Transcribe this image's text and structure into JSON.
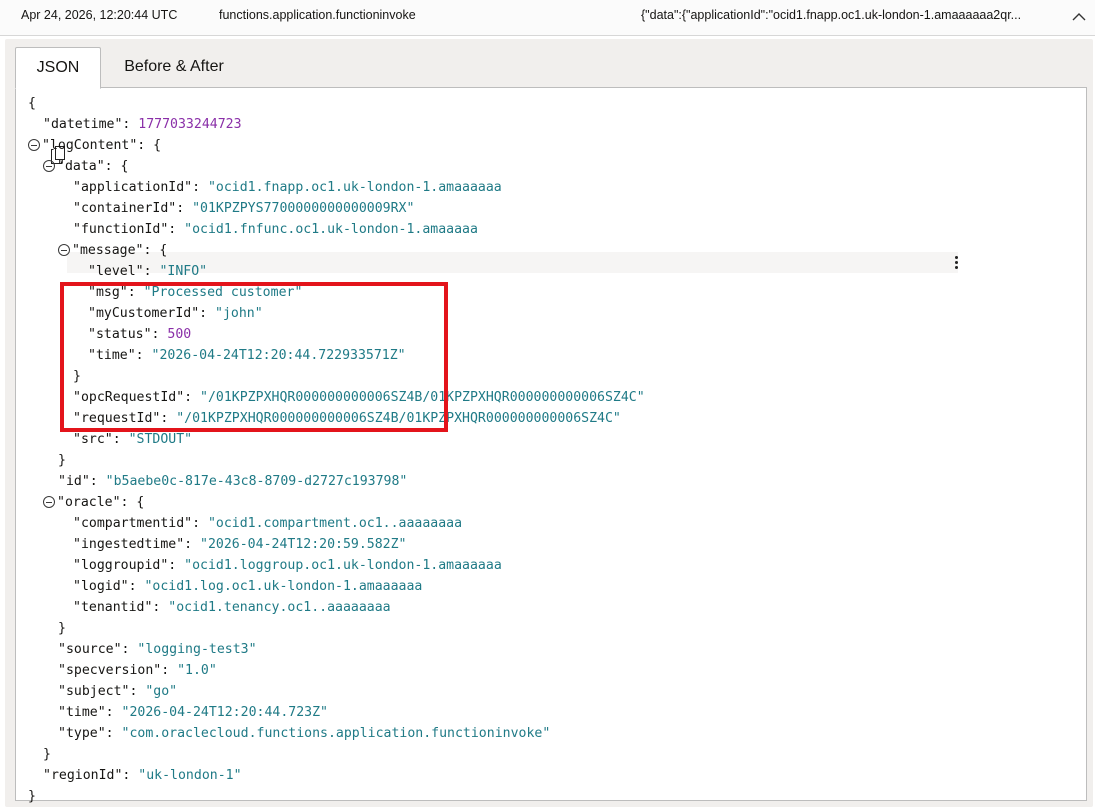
{
  "header": {
    "timestamp": "Apr 24, 2026, 12:20:44 UTC",
    "type": "functions.application.functioninvoke",
    "data_preview": "{\"data\":{\"applicationId\":\"ocid1.fnapp.oc1.uk-london-1.amaaaaaa2qr..."
  },
  "tabs": [
    {
      "label": "JSON",
      "active": true
    },
    {
      "label": "Before & After",
      "active": false
    }
  ],
  "icons": {
    "copy": "copy-icon",
    "collapse": "chevron-up-icon",
    "toggle": "collapse-toggle-icon",
    "kebab": "more-vertical-icon"
  },
  "colors": {
    "string": "#1f7a86",
    "number": "#8a2fa8",
    "highlight": "#e3141b"
  },
  "json_lines": [
    {
      "indent": 0,
      "parts": [
        {
          "t": "p",
          "v": "{"
        }
      ],
      "copy": true
    },
    {
      "indent": 1,
      "parts": [
        {
          "t": "k",
          "v": "\"datetime\""
        },
        {
          "t": "p",
          "v": ": "
        },
        {
          "t": "n",
          "v": "1777033244723"
        }
      ]
    },
    {
      "indent": 1,
      "toggle": true,
      "parts": [
        {
          "t": "k",
          "v": "\"logContent\""
        },
        {
          "t": "p",
          "v": ": {"
        }
      ]
    },
    {
      "indent": 2,
      "toggle": true,
      "parts": [
        {
          "t": "k",
          "v": "\"data\""
        },
        {
          "t": "p",
          "v": ": {"
        }
      ]
    },
    {
      "indent": 3,
      "parts": [
        {
          "t": "k",
          "v": "\"applicationId\""
        },
        {
          "t": "p",
          "v": ": "
        },
        {
          "t": "s",
          "v": "\"ocid1.fnapp.oc1.uk-london-1.amaaaaaa"
        }
      ]
    },
    {
      "indent": 3,
      "hover": true,
      "parts": [
        {
          "t": "k",
          "v": "\"containerId\""
        },
        {
          "t": "p",
          "v": ": "
        },
        {
          "t": "s",
          "v": "\"01KPZPYS7700000000000009RX\""
        }
      ]
    },
    {
      "indent": 3,
      "parts": [
        {
          "t": "k",
          "v": "\"functionId\""
        },
        {
          "t": "p",
          "v": ": "
        },
        {
          "t": "s",
          "v": "\"ocid1.fnfunc.oc1.uk-london-1.amaaaaa"
        }
      ]
    },
    {
      "indent": 3,
      "toggle": true,
      "parts": [
        {
          "t": "k",
          "v": "\"message\""
        },
        {
          "t": "p",
          "v": ": {"
        }
      ]
    },
    {
      "indent": 4,
      "parts": [
        {
          "t": "k",
          "v": "\"level\""
        },
        {
          "t": "p",
          "v": ": "
        },
        {
          "t": "s",
          "v": "\"INFO\""
        }
      ]
    },
    {
      "indent": 4,
      "parts": [
        {
          "t": "k",
          "v": "\"msg\""
        },
        {
          "t": "p",
          "v": ": "
        },
        {
          "t": "s",
          "v": "\"Processed customer\""
        }
      ]
    },
    {
      "indent": 4,
      "parts": [
        {
          "t": "k",
          "v": "\"myCustomerId\""
        },
        {
          "t": "p",
          "v": ": "
        },
        {
          "t": "s",
          "v": "\"john\""
        }
      ]
    },
    {
      "indent": 4,
      "parts": [
        {
          "t": "k",
          "v": "\"status\""
        },
        {
          "t": "p",
          "v": ": "
        },
        {
          "t": "n",
          "v": "500"
        }
      ]
    },
    {
      "indent": 4,
      "parts": [
        {
          "t": "k",
          "v": "\"time\""
        },
        {
          "t": "p",
          "v": ": "
        },
        {
          "t": "s",
          "v": "\"2026-04-24T12:20:44.722933571Z\""
        }
      ]
    },
    {
      "indent": 3,
      "parts": [
        {
          "t": "p",
          "v": "}"
        }
      ]
    },
    {
      "indent": 3,
      "parts": [
        {
          "t": "k",
          "v": "\"opcRequestId\""
        },
        {
          "t": "p",
          "v": ": "
        },
        {
          "t": "s",
          "v": "\"/01KPZPXHQR000000000006SZ4B/01KPZPXHQR000000000006SZ4C\""
        }
      ]
    },
    {
      "indent": 3,
      "parts": [
        {
          "t": "k",
          "v": "\"requestId\""
        },
        {
          "t": "p",
          "v": ": "
        },
        {
          "t": "s",
          "v": "\"/01KPZPXHQR000000000006SZ4B/01KPZPXHQR000000000006SZ4C\""
        }
      ]
    },
    {
      "indent": 3,
      "parts": [
        {
          "t": "k",
          "v": "\"src\""
        },
        {
          "t": "p",
          "v": ": "
        },
        {
          "t": "s",
          "v": "\"STDOUT\""
        }
      ]
    },
    {
      "indent": 2,
      "parts": [
        {
          "t": "p",
          "v": "}"
        }
      ]
    },
    {
      "indent": 2,
      "parts": [
        {
          "t": "k",
          "v": "\"id\""
        },
        {
          "t": "p",
          "v": ": "
        },
        {
          "t": "s",
          "v": "\"b5aebe0c-817e-43c8-8709-d2727c193798\""
        }
      ]
    },
    {
      "indent": 2,
      "toggle": true,
      "parts": [
        {
          "t": "k",
          "v": "\"oracle\""
        },
        {
          "t": "p",
          "v": ": {"
        }
      ]
    },
    {
      "indent": 3,
      "parts": [
        {
          "t": "k",
          "v": "\"compartmentid\""
        },
        {
          "t": "p",
          "v": ": "
        },
        {
          "t": "s",
          "v": "\"ocid1.compartment.oc1..aaaaaaaa"
        }
      ]
    },
    {
      "indent": 3,
      "parts": [
        {
          "t": "k",
          "v": "\"ingestedtime\""
        },
        {
          "t": "p",
          "v": ": "
        },
        {
          "t": "s",
          "v": "\"2026-04-24T12:20:59.582Z\""
        }
      ]
    },
    {
      "indent": 3,
      "parts": [
        {
          "t": "k",
          "v": "\"loggroupid\""
        },
        {
          "t": "p",
          "v": ": "
        },
        {
          "t": "s",
          "v": "\"ocid1.loggroup.oc1.uk-london-1.amaaaaaa"
        }
      ]
    },
    {
      "indent": 3,
      "parts": [
        {
          "t": "k",
          "v": "\"logid\""
        },
        {
          "t": "p",
          "v": ": "
        },
        {
          "t": "s",
          "v": "\"ocid1.log.oc1.uk-london-1.amaaaaaa"
        }
      ]
    },
    {
      "indent": 3,
      "parts": [
        {
          "t": "k",
          "v": "\"tenantid\""
        },
        {
          "t": "p",
          "v": ": "
        },
        {
          "t": "s",
          "v": "\"ocid1.tenancy.oc1..aaaaaaaa"
        }
      ]
    },
    {
      "indent": 2,
      "parts": [
        {
          "t": "p",
          "v": "}"
        }
      ]
    },
    {
      "indent": 2,
      "parts": [
        {
          "t": "k",
          "v": "\"source\""
        },
        {
          "t": "p",
          "v": ": "
        },
        {
          "t": "s",
          "v": "\"logging-test3\""
        }
      ]
    },
    {
      "indent": 2,
      "parts": [
        {
          "t": "k",
          "v": "\"specversion\""
        },
        {
          "t": "p",
          "v": ": "
        },
        {
          "t": "s",
          "v": "\"1.0\""
        }
      ]
    },
    {
      "indent": 2,
      "parts": [
        {
          "t": "k",
          "v": "\"subject\""
        },
        {
          "t": "p",
          "v": ": "
        },
        {
          "t": "s",
          "v": "\"go\""
        }
      ]
    },
    {
      "indent": 2,
      "parts": [
        {
          "t": "k",
          "v": "\"time\""
        },
        {
          "t": "p",
          "v": ": "
        },
        {
          "t": "s",
          "v": "\"2026-04-24T12:20:44.723Z\""
        }
      ]
    },
    {
      "indent": 2,
      "parts": [
        {
          "t": "k",
          "v": "\"type\""
        },
        {
          "t": "p",
          "v": ": "
        },
        {
          "t": "s",
          "v": "\"com.oraclecloud.functions.application.functioninvoke\""
        }
      ]
    },
    {
      "indent": 1,
      "parts": [
        {
          "t": "p",
          "v": "}"
        }
      ]
    },
    {
      "indent": 1,
      "parts": [
        {
          "t": "k",
          "v": "\"regionId\""
        },
        {
          "t": "p",
          "v": ": "
        },
        {
          "t": "s",
          "v": "\"uk-london-1\""
        }
      ]
    },
    {
      "indent": 0,
      "parts": [
        {
          "t": "p",
          "v": "}"
        }
      ]
    }
  ]
}
